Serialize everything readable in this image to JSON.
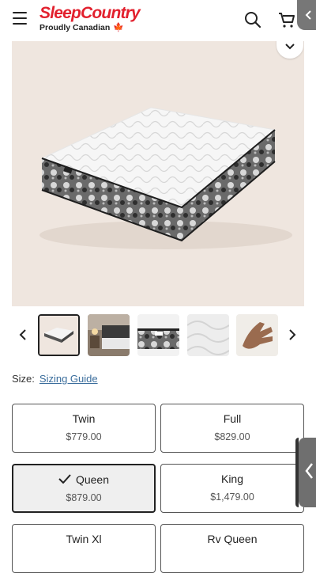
{
  "header": {
    "brand": "SleepCountry",
    "tagline": "Proudly Canadian",
    "menu_icon": "hamburger-menu-icon",
    "search_icon": "search-icon",
    "cart_icon": "cart-icon",
    "corner_icon": "chevron-left-icon"
  },
  "gallery": {
    "collapse_icon": "chevron-down-icon",
    "prev_icon": "chevron-left-icon",
    "next_icon": "chevron-right-icon",
    "thumbnails": [
      {
        "name": "mattress-angle",
        "active": true
      },
      {
        "name": "bedroom-scene",
        "active": false
      },
      {
        "name": "mattress-side-detail",
        "active": false
      },
      {
        "name": "quilted-top-detail",
        "active": false
      },
      {
        "name": "hand-pressing-foam",
        "active": false
      }
    ]
  },
  "size": {
    "label": "Size:",
    "guide_link": "Sizing Guide",
    "options": [
      {
        "name": "Twin",
        "price": "$779.00",
        "selected": false
      },
      {
        "name": "Full",
        "price": "$829.00",
        "selected": false
      },
      {
        "name": "Queen",
        "price": "$879.00",
        "selected": true
      },
      {
        "name": "King",
        "price": "$1,479.00",
        "selected": false
      },
      {
        "name": "Twin Xl",
        "price": "",
        "selected": false
      },
      {
        "name": "Rv Queen",
        "price": "",
        "selected": false
      }
    ]
  },
  "side_tab_icon": "chevron-left-icon",
  "colors": {
    "brand_red": "#e2202d",
    "link_blue": "#3a6d9c",
    "hero_bg": "#efe6df"
  }
}
